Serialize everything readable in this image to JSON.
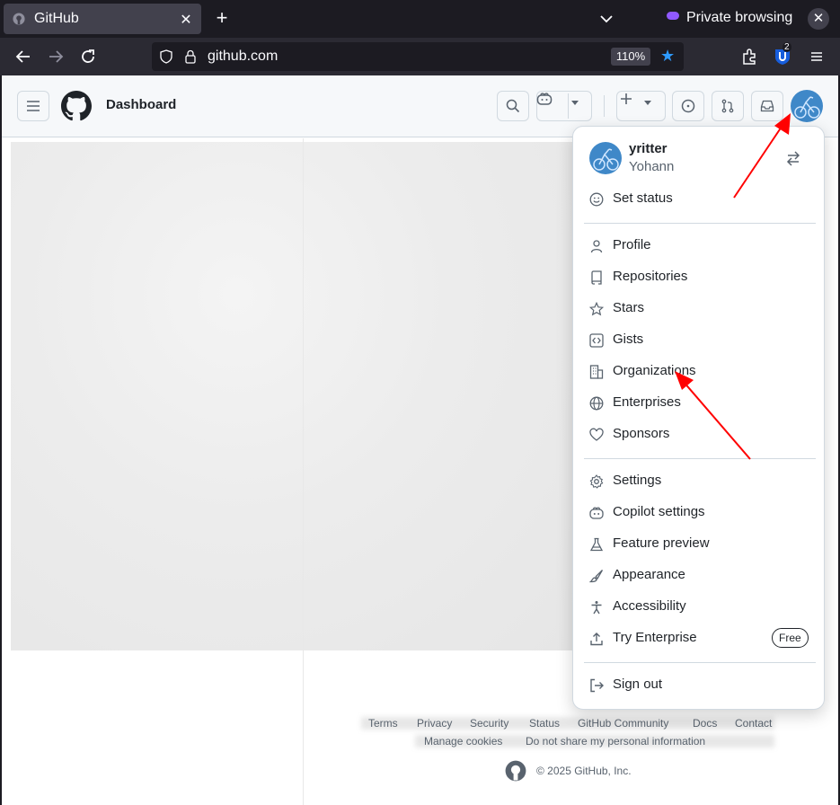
{
  "browser": {
    "tab_title": "GitHub",
    "tab_close": "✕",
    "new_tab": "+",
    "private_label": "Private browsing",
    "private_close": "✕",
    "url": "github.com",
    "zoom": "110%",
    "extension_badge": "2"
  },
  "header": {
    "title": "Dashboard"
  },
  "menu": {
    "username": "yritter",
    "display_name": "Yohann",
    "items": [
      {
        "label": "Set status",
        "icon": "smiley-icon"
      },
      {
        "label": "Profile",
        "icon": "person-icon"
      },
      {
        "label": "Repositories",
        "icon": "repo-icon"
      },
      {
        "label": "Stars",
        "icon": "star-icon"
      },
      {
        "label": "Gists",
        "icon": "code-square-icon"
      },
      {
        "label": "Organizations",
        "icon": "organization-icon"
      },
      {
        "label": "Enterprises",
        "icon": "globe-icon"
      },
      {
        "label": "Sponsors",
        "icon": "heart-icon"
      },
      {
        "label": "Settings",
        "icon": "gear-icon"
      },
      {
        "label": "Copilot settings",
        "icon": "copilot-icon"
      },
      {
        "label": "Feature preview",
        "icon": "beaker-icon"
      },
      {
        "label": "Appearance",
        "icon": "paintbrush-icon"
      },
      {
        "label": "Accessibility",
        "icon": "accessibility-icon"
      },
      {
        "label": "Try Enterprise",
        "icon": "upload-icon",
        "badge": "Free"
      },
      {
        "label": "Sign out",
        "icon": "sign-out-icon"
      }
    ]
  },
  "footer": {
    "links": [
      "Terms",
      "Privacy",
      "Security",
      "Status",
      "GitHub Community",
      "Docs",
      "Contact",
      "Manage cookies",
      "Do not share my personal information"
    ],
    "copyright": "© 2025 GitHub, Inc."
  },
  "colors": {
    "accent": "#0969da",
    "annotation_arrow": "#ff0000",
    "avatar_bg": "#3f88c8"
  }
}
